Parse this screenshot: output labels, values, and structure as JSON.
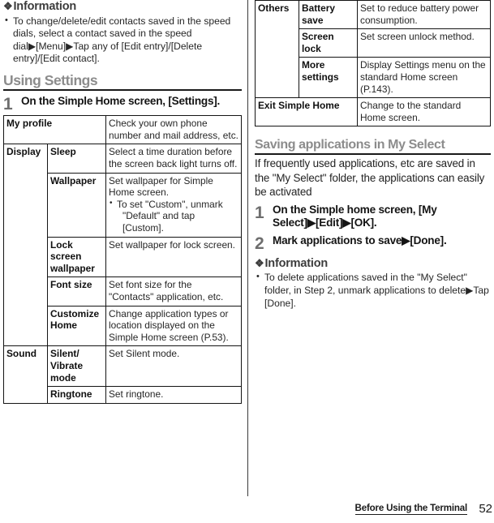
{
  "page": {
    "number": "52",
    "footer_label": "Before Using the Terminal"
  },
  "left_column": {
    "information": {
      "heading": "Information",
      "diamond_icon": "❖",
      "bullets": [
        "To change/delete/edit contacts saved in the speed dials, select a contact saved in the speed dial▶[Menu]▶Tap any of [Edit entry]/[Delete entry]/[Edit contact]."
      ]
    },
    "section": {
      "heading": "Using Settings"
    },
    "step": {
      "number": "1",
      "text": "On the Simple Home screen, [Settings]."
    },
    "settings_table": {
      "rows": [
        {
          "category": "My profile",
          "category_span": 2,
          "item": "",
          "description": "Check your own phone number and mail address, etc."
        },
        {
          "category": "Display",
          "item": "Sleep",
          "description": "Select a time duration before the screen back light turns off."
        },
        {
          "category": "",
          "item": "Wallpaper",
          "description": "Set wallpaper for Simple Home screen.",
          "sub_bullets": [
            {
              "line1": "To set \"Custom\", unmark",
              "line2": "\"Default\" and tap [Custom]."
            }
          ]
        },
        {
          "category": "",
          "item": "Lock screen wallpaper",
          "description": "Set wallpaper for lock screen."
        },
        {
          "category": "",
          "item": "Font size",
          "description": "Set font size for the \"Contacts\" application, etc."
        },
        {
          "category": "",
          "item": "Customize Home",
          "description": "Change application types or location displayed on the Simple Home screen (P.53)."
        },
        {
          "category": "Sound",
          "item": "Silent/ Vibrate mode",
          "description": "Set Silent mode."
        },
        {
          "category": "",
          "item": "Ringtone",
          "description": "Set ringtone."
        }
      ]
    }
  },
  "right_column": {
    "settings_table_cont": {
      "rows": [
        {
          "category": "Others",
          "item": "Battery save",
          "description": "Set to reduce battery power consumption."
        },
        {
          "category": "",
          "item": "Screen lock",
          "description": "Set screen unlock method."
        },
        {
          "category": "",
          "item": "More settings",
          "description": "Display Settings menu on the standard Home screen (P.143)."
        },
        {
          "category": "Exit Simple Home",
          "category_span": 2,
          "item": "",
          "description": "Change to the standard Home screen."
        }
      ]
    },
    "section": {
      "heading": "Saving applications in My Select",
      "intro": "If frequently used applications, etc are saved in the \"My Select\" folder, the applications can easily be activated"
    },
    "steps": [
      {
        "number": "1",
        "text": "On the Simple home screen, [My Select]▶[Edit]▶[OK]."
      },
      {
        "number": "2",
        "text": "Mark applications to save▶[Done]."
      }
    ],
    "information": {
      "heading": "Information",
      "diamond_icon": "❖",
      "bullets": [
        "To delete applications saved in the \"My Select\" folder, in Step 2, unmark applications to delete▶Tap [Done]."
      ]
    }
  }
}
